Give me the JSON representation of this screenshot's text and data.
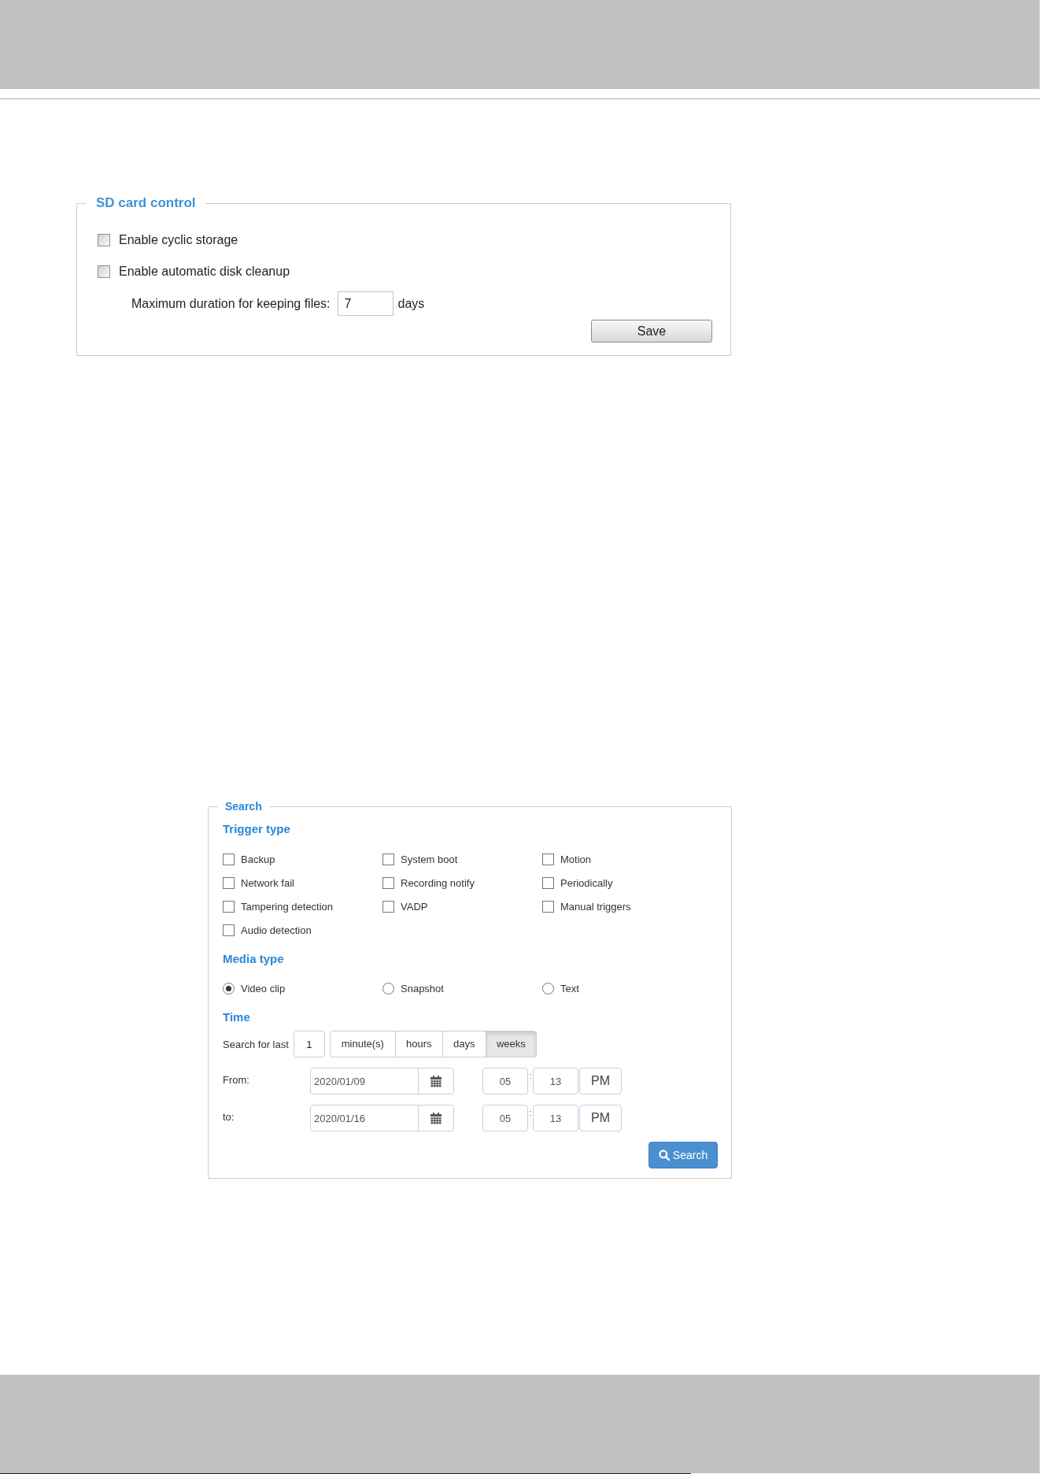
{
  "sd_card_control": {
    "title": "SD card control",
    "options": [
      {
        "label": "Enable cyclic storage",
        "checked": false
      },
      {
        "label": "Enable automatic disk cleanup",
        "checked": false
      }
    ],
    "max_duration": {
      "label": "Maximum duration for keeping files:",
      "value": "7",
      "unit": "days"
    },
    "save_button": "Save"
  },
  "search": {
    "title": "Search",
    "trigger_type": {
      "heading": "Trigger type",
      "options": [
        {
          "label": "Backup",
          "checked": false
        },
        {
          "label": "System boot",
          "checked": false
        },
        {
          "label": "Motion",
          "checked": false
        },
        {
          "label": "Network fail",
          "checked": false
        },
        {
          "label": "Recording notify",
          "checked": false
        },
        {
          "label": "Periodically",
          "checked": false
        },
        {
          "label": "Tampering detection",
          "checked": false
        },
        {
          "label": "VADP",
          "checked": false
        },
        {
          "label": "Manual triggers",
          "checked": false
        },
        {
          "label": "Audio detection",
          "checked": false
        }
      ]
    },
    "media_type": {
      "heading": "Media type",
      "options": [
        {
          "label": "Video clip",
          "selected": true
        },
        {
          "label": "Snapshot",
          "selected": false
        },
        {
          "label": "Text",
          "selected": false
        }
      ]
    },
    "time": {
      "heading": "Time",
      "search_for_last": {
        "label": "Search for last",
        "value": "1",
        "units": [
          {
            "label": "minute(s)",
            "selected": false
          },
          {
            "label": "hours",
            "selected": false
          },
          {
            "label": "days",
            "selected": false
          },
          {
            "label": "weeks",
            "selected": true
          }
        ]
      },
      "ranges": [
        {
          "label": "From:",
          "date": "2020/01/09",
          "hour": "05",
          "separator": ":",
          "minute": "13",
          "period": "PM"
        },
        {
          "label": "to:",
          "date": "2020/01/16",
          "hour": "05",
          "separator": ":",
          "minute": "13",
          "period": "PM"
        }
      ]
    },
    "search_button": "Search"
  }
}
